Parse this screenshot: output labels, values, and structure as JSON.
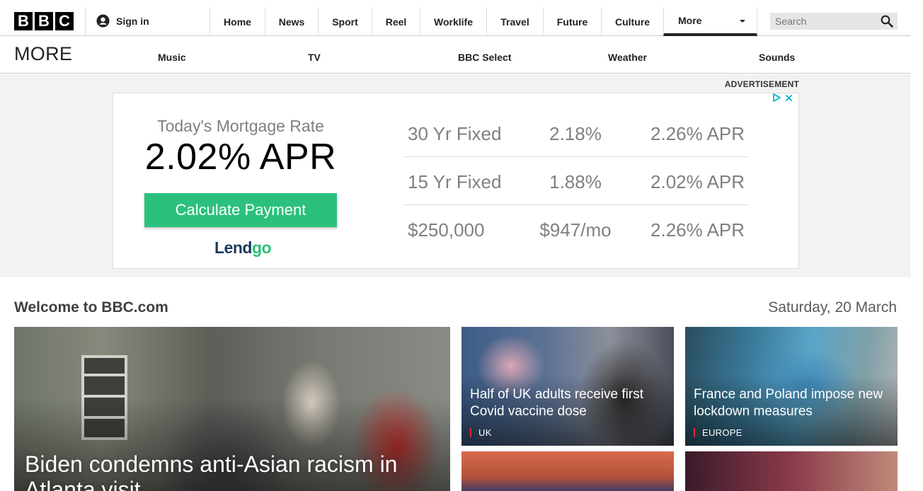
{
  "header": {
    "logo_letters": [
      "B",
      "B",
      "C"
    ],
    "sign_in": "Sign in",
    "nav": [
      "Home",
      "News",
      "Sport",
      "Reel",
      "Worklife",
      "Travel",
      "Future",
      "Culture"
    ],
    "more": "More",
    "search_placeholder": "Search"
  },
  "subnav": {
    "title": "MORE",
    "links": [
      "Music",
      "TV",
      "BBC Select",
      "Weather",
      "Sounds"
    ]
  },
  "ad": {
    "label": "ADVERTISEMENT",
    "subtitle": "Today's Mortgage Rate",
    "rate": "2.02% APR",
    "button": "Calculate Payment",
    "brand_part1": "Lend",
    "brand_part2": "go",
    "rows": [
      [
        "30 Yr Fixed",
        "2.18%",
        "2.26% APR"
      ],
      [
        "15 Yr Fixed",
        "1.88%",
        "2.02% APR"
      ],
      [
        "$250,000",
        "$947/mo",
        "2.26% APR"
      ]
    ]
  },
  "main": {
    "welcome": "Welcome to BBC.com",
    "date": "Saturday, 20 March",
    "stories": {
      "lead": {
        "headline": "Biden condemns anti-Asian racism in Atlanta visit"
      },
      "s1": {
        "headline": "Half of UK adults receive first Covid vaccine dose",
        "tag": "UK"
      },
      "s2": {
        "headline": "France and Poland impose new lockdown measures",
        "tag": "EUROPE"
      }
    }
  },
  "colors": {
    "accent": "#2bc17c",
    "tag_bar": "#e32a2a",
    "brand_dark": "#1d3a5c"
  }
}
